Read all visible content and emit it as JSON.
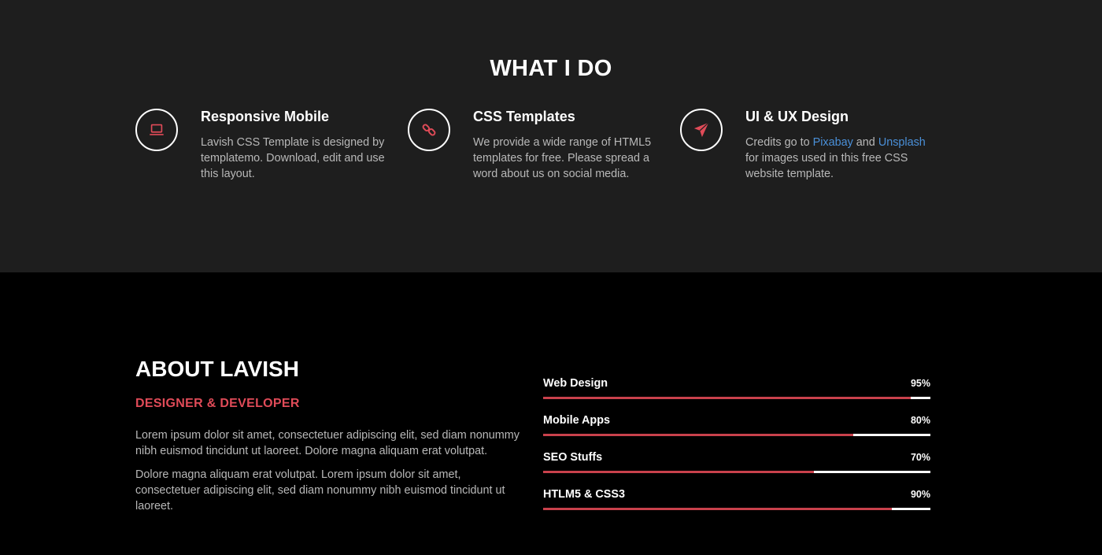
{
  "services": {
    "title": "WHAT I DO",
    "items": [
      {
        "icon": "laptop-icon",
        "title": "Responsive Mobile",
        "desc": "Lavish CSS Template is designed by templatemo. Download, edit and use this layout."
      },
      {
        "icon": "link-icon",
        "title": "CSS Templates",
        "desc": "We provide a wide range of HTML5 templates for free. Please spread a word about us on social media."
      },
      {
        "icon": "paper-plane-icon",
        "title": "UI & UX Design",
        "desc_before": "Credits go to",
        "link1": "Pixabay",
        "desc_mid": "and",
        "link2": "Unsplash",
        "desc_after": "for images used in this free CSS website template."
      }
    ]
  },
  "about": {
    "title": "ABOUT LAVISH",
    "subtitle": "DESIGNER & DEVELOPER",
    "p1": "Lorem ipsum dolor sit amet, consectetuer adipiscing elit, sed diam nonummy nibh euismod tincidunt ut laoreet. Dolore magna aliquam erat volutpat.",
    "p2": "Dolore magna aliquam erat volutpat. Lorem ipsum dolor sit amet, consectetuer adipiscing elit, sed diam nonummy nibh euismod tincidunt ut laoreet."
  },
  "skills": [
    {
      "name": "Web Design",
      "percent_label": "95%",
      "value": 95
    },
    {
      "name": "Mobile Apps",
      "percent_label": "80%",
      "value": 80
    },
    {
      "name": "SEO Stuffs",
      "percent_label": "70%",
      "value": 70
    },
    {
      "name": "HTLM5 & CSS3",
      "percent_label": "90%",
      "value": 90
    }
  ],
  "colors": {
    "accent": "#e04b58",
    "bar_fill": "#c9414c",
    "link": "#4a90d9",
    "services_bg": "#1e1e1e",
    "about_bg": "#000000"
  }
}
